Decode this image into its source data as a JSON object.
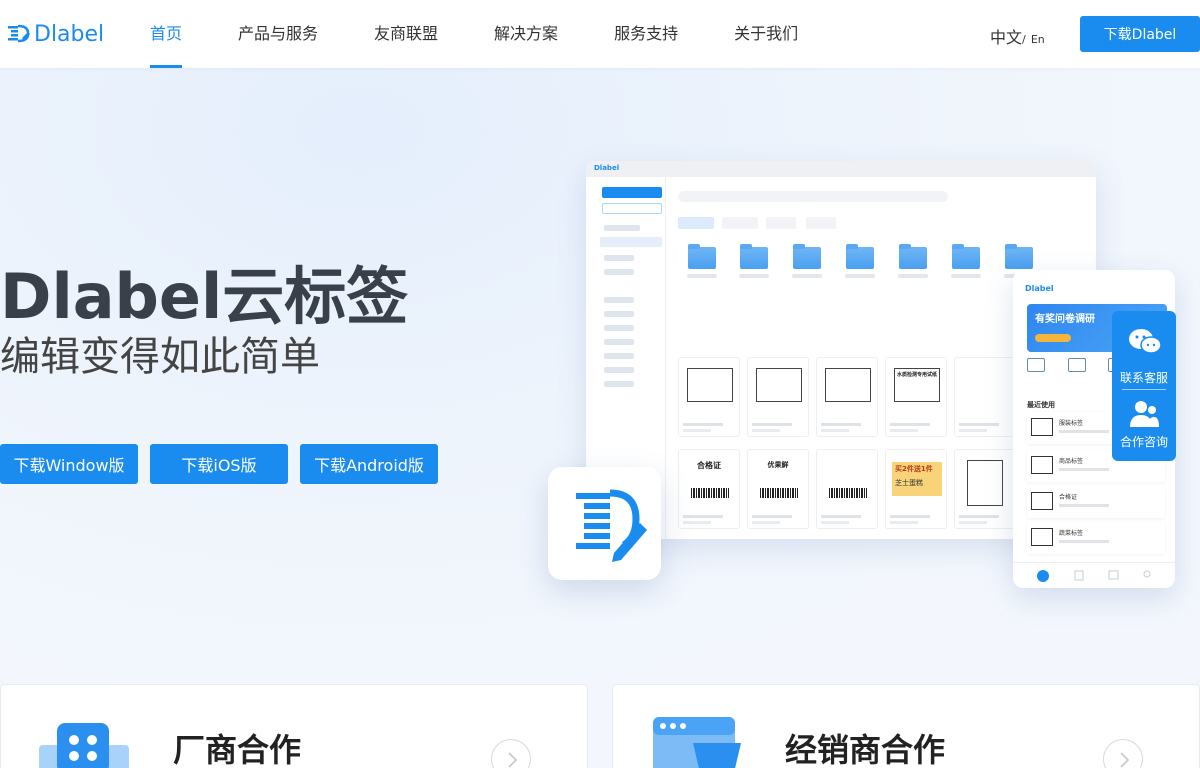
{
  "brand": {
    "logo_text": "Dlabel"
  },
  "nav": {
    "items": [
      {
        "label": "首页",
        "active": true
      },
      {
        "label": "产品与服务",
        "active": false
      },
      {
        "label": "友商联盟",
        "active": false
      },
      {
        "label": "解决方案",
        "active": false
      },
      {
        "label": "服务支持",
        "active": false
      },
      {
        "label": "关于我们",
        "active": false
      }
    ],
    "lang_main": "中文",
    "lang_sep": "/",
    "lang_alt": "En",
    "download_label": "下载Dlabel"
  },
  "hero": {
    "title": "Dlabel云标签",
    "subtitle": "编辑变得如此简单",
    "buttons": [
      "下载Window版",
      "下载iOS版",
      "下载Android版"
    ]
  },
  "mockup": {
    "app_tab": "Dlabel",
    "cards": [
      "合格证",
      "优果鲜",
      "水质检测专用试纸",
      "买2件送1件",
      "芝士蛋糕"
    ],
    "phone_banner": "有奖问卷调研",
    "phone_recent": "最近使用",
    "phone_items": [
      "服装标签",
      "商品标签",
      "合格证",
      "蔬菜标签"
    ]
  },
  "contact": {
    "service_label": "联系客服",
    "consult_label": "合作咨询"
  },
  "cooperation": {
    "vendor_title": "厂商合作",
    "dealer_title": "经销商合作"
  },
  "colors": {
    "accent": "#1a8cf0",
    "text_dark": "#3a4049"
  }
}
